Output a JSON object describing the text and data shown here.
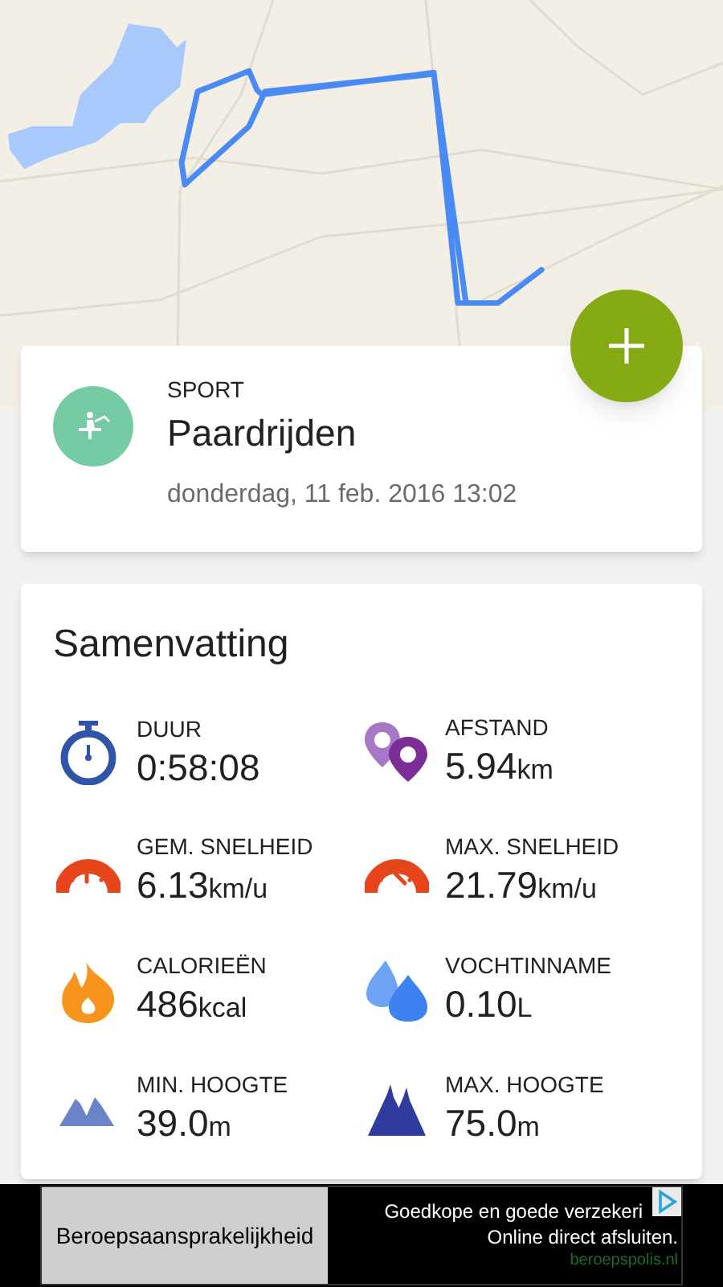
{
  "activity": {
    "label": "SPORT",
    "name": "Paardrijden",
    "date": "donderdag, 11 feb. 2016 13:02"
  },
  "summary": {
    "title": "Samenvatting",
    "stats": [
      {
        "kind": "stopwatch",
        "label": "DUUR",
        "value": "0:58:08"
      },
      {
        "kind": "distance",
        "label": "AFSTAND",
        "value": "5.94",
        "unit": "km"
      },
      {
        "kind": "speed-avg",
        "label": "GEM. SNELHEID",
        "value": "6.13",
        "unit": "km/u"
      },
      {
        "kind": "speed-max",
        "label": "MAX. SNELHEID",
        "value": "21.79",
        "unit": "km/u"
      },
      {
        "kind": "calories",
        "label": "CALORIEËN",
        "value": "486",
        "unit": "kcal"
      },
      {
        "kind": "hydration",
        "label": "VOCHTINNAME",
        "value": "0.10",
        "unit": "L"
      },
      {
        "kind": "alt-min",
        "label": "MIN. HOOGTE",
        "value": "39.0",
        "unit": "m"
      },
      {
        "kind": "alt-max",
        "label": "MAX. HOOGTE",
        "value": "75.0",
        "unit": "m"
      }
    ]
  },
  "ad": {
    "button": "Beroepsaansprakelijkheid",
    "headline": "Goedkope en goede verzekeri",
    "text": "Online direct afsluiten.",
    "url": "beroepspolis.nl"
  }
}
